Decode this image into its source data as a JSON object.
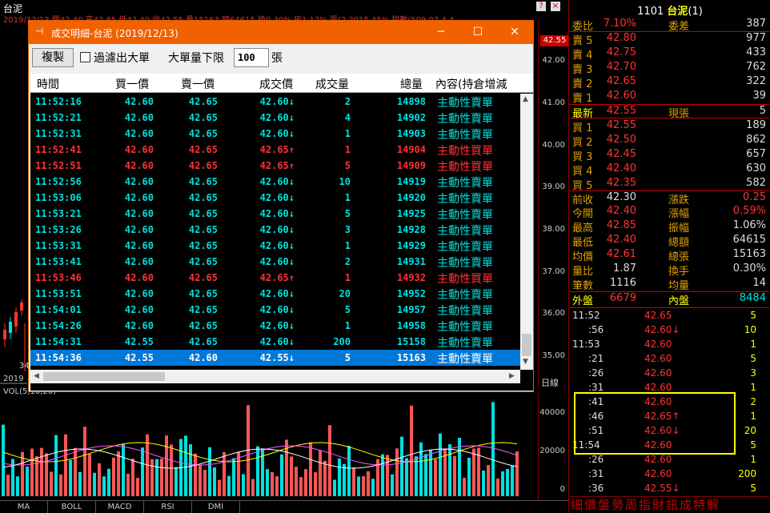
{
  "chart": {
    "title": "台泥",
    "infoline": "2019/12/13  開42.40 高42.85 低42.40 收42.55 量15163 額64615 換0.30% 振1.12% 張(2.2015.45% 指數(509.07 4.4",
    "price_ticks": [
      "42.00",
      "41.00",
      "40.00",
      "39.00",
      "38.00",
      "37.00",
      "36.00",
      "35.00"
    ],
    "current_price": "42.55",
    "rilou_label": "日線",
    "year_label": "2019",
    "small_label": "34",
    "vol_label": "VOL(5,10,20)",
    "vol_ticks": [
      "40000",
      "20000",
      "0"
    ],
    "tabs": [
      "MA",
      "BOLL",
      "MACD",
      "RSI",
      "DMI"
    ]
  },
  "dialog": {
    "title": "成交明細-台泥 (2019/12/13)",
    "copy_label": "複製",
    "filter_label": "過濾出大單",
    "min_label": "大單量下限",
    "min_value": "100",
    "min_unit": "張",
    "columns": [
      "時間",
      "買一價",
      "賣一價",
      "成交價",
      "成交量",
      "總量",
      "內容(持倉增減"
    ],
    "rows": [
      {
        "time": "11:52:16",
        "bid": "42.60",
        "ask": "42.65",
        "price": "42.60↓",
        "vol": "2",
        "total": "14898",
        "content": "主動性賣單",
        "side": "sell"
      },
      {
        "time": "11:52:21",
        "bid": "42.60",
        "ask": "42.65",
        "price": "42.60↓",
        "vol": "4",
        "total": "14902",
        "content": "主動性賣單",
        "side": "sell"
      },
      {
        "time": "11:52:31",
        "bid": "42.60",
        "ask": "42.65",
        "price": "42.60↓",
        "vol": "1",
        "total": "14903",
        "content": "主動性賣單",
        "side": "sell"
      },
      {
        "time": "11:52:41",
        "bid": "42.60",
        "ask": "42.65",
        "price": "42.65↑",
        "vol": "1",
        "total": "14904",
        "content": "主動性買單",
        "side": "buy"
      },
      {
        "time": "11:52:51",
        "bid": "42.60",
        "ask": "42.65",
        "price": "42.65↑",
        "vol": "5",
        "total": "14909",
        "content": "主動性買單",
        "side": "buy"
      },
      {
        "time": "11:52:56",
        "bid": "42.60",
        "ask": "42.65",
        "price": "42.60↓",
        "vol": "10",
        "total": "14919",
        "content": "主動性賣單",
        "side": "sell"
      },
      {
        "time": "11:53:06",
        "bid": "42.60",
        "ask": "42.65",
        "price": "42.60↓",
        "vol": "1",
        "total": "14920",
        "content": "主動性賣單",
        "side": "sell"
      },
      {
        "time": "11:53:21",
        "bid": "42.60",
        "ask": "42.65",
        "price": "42.60↓",
        "vol": "5",
        "total": "14925",
        "content": "主動性賣單",
        "side": "sell"
      },
      {
        "time": "11:53:26",
        "bid": "42.60",
        "ask": "42.65",
        "price": "42.60↓",
        "vol": "3",
        "total": "14928",
        "content": "主動性賣單",
        "side": "sell"
      },
      {
        "time": "11:53:31",
        "bid": "42.60",
        "ask": "42.65",
        "price": "42.60↓",
        "vol": "1",
        "total": "14929",
        "content": "主動性賣單",
        "side": "sell"
      },
      {
        "time": "11:53:41",
        "bid": "42.60",
        "ask": "42.65",
        "price": "42.60↓",
        "vol": "2",
        "total": "14931",
        "content": "主動性賣單",
        "side": "sell"
      },
      {
        "time": "11:53:46",
        "bid": "42.60",
        "ask": "42.65",
        "price": "42.65↑",
        "vol": "1",
        "total": "14932",
        "content": "主動性買單",
        "side": "buy"
      },
      {
        "time": "11:53:51",
        "bid": "42.60",
        "ask": "42.65",
        "price": "42.60↓",
        "vol": "20",
        "total": "14952",
        "content": "主動性賣單",
        "side": "sell"
      },
      {
        "time": "11:54:01",
        "bid": "42.60",
        "ask": "42.65",
        "price": "42.60↓",
        "vol": "5",
        "total": "14957",
        "content": "主動性賣單",
        "side": "sell"
      },
      {
        "time": "11:54:26",
        "bid": "42.60",
        "ask": "42.65",
        "price": "42.60↓",
        "vol": "1",
        "total": "14958",
        "content": "主動性賣單",
        "side": "sell"
      },
      {
        "time": "11:54:31",
        "bid": "42.55",
        "ask": "42.65",
        "price": "42.60↓",
        "vol": "200",
        "total": "15158",
        "content": "主動性賣單",
        "side": "sell"
      },
      {
        "time": "11:54:36",
        "bid": "42.55",
        "ask": "42.60",
        "price": "42.55↓",
        "vol": "5",
        "total": "15163",
        "content": "主動性賣單",
        "side": "sell",
        "selected": true
      }
    ]
  },
  "quote": {
    "code": "1101",
    "name": "台泥",
    "suffix": "(1)",
    "ratio_label": "委比",
    "ratio_value": "7.10%",
    "diff_label": "委差",
    "diff_value": "387",
    "asks": [
      {
        "label": "賣 5",
        "price": "42.80",
        "vol": "977"
      },
      {
        "label": "賣 4",
        "price": "42.75",
        "vol": "433"
      },
      {
        "label": "賣 3",
        "price": "42.70",
        "vol": "762"
      },
      {
        "label": "賣 2",
        "price": "42.65",
        "vol": "322"
      },
      {
        "label": "賣 1",
        "price": "42.60",
        "vol": "39"
      }
    ],
    "last_label": "最新",
    "last_price": "42.55",
    "cur_label": "現張",
    "cur_vol": "5",
    "bids": [
      {
        "label": "買 1",
        "price": "42.55",
        "vol": "189"
      },
      {
        "label": "買 2",
        "price": "42.50",
        "vol": "862"
      },
      {
        "label": "買 3",
        "price": "42.45",
        "vol": "657"
      },
      {
        "label": "買 4",
        "price": "42.40",
        "vol": "630"
      },
      {
        "label": "買 5",
        "price": "42.35",
        "vol": "582"
      }
    ],
    "stats": [
      {
        "l1": "前收",
        "v1": "42.30",
        "l2": "漲跌",
        "v2": "0.25"
      },
      {
        "l1": "今開",
        "v1": "42.40",
        "l2": "漲幅",
        "v2": "0.59%"
      },
      {
        "l1": "最高",
        "v1": "42.85",
        "l2": "振幅",
        "v2": "1.06%"
      },
      {
        "l1": "最低",
        "v1": "42.40",
        "l2": "總額",
        "v2": "64615"
      },
      {
        "l1": "均價",
        "v1": "42.61",
        "l2": "總張",
        "v2": "15163"
      },
      {
        "l1": "量比",
        "v1": "1.87",
        "l2": "換手",
        "v2": "0.30%"
      },
      {
        "l1": "筆數",
        "v1": "1116",
        "l2": "均量",
        "v2": "14"
      }
    ],
    "outer_label": "外盤",
    "outer_value": "6679",
    "inner_label": "內盤",
    "inner_value": "8484",
    "ticks": [
      {
        "time": "11:52",
        "price": "42.65",
        "vol": "5",
        "dir": "up"
      },
      {
        "time": ":56",
        "price": "42.60↓",
        "vol": "10",
        "dir": "down"
      },
      {
        "time": "11:53",
        "price": "42.60",
        "vol": "1",
        "dir": "down"
      },
      {
        "time": ":21",
        "price": "42.60",
        "vol": "5",
        "dir": "down"
      },
      {
        "time": ":26",
        "price": "42.60",
        "vol": "3",
        "dir": "down"
      },
      {
        "time": ":31",
        "price": "42.60",
        "vol": "1",
        "dir": "down"
      },
      {
        "time": ":41",
        "price": "42.60",
        "vol": "2",
        "dir": "down"
      },
      {
        "time": ":46",
        "price": "42.65↑",
        "vol": "1",
        "dir": "up"
      },
      {
        "time": ":51",
        "price": "42.60↓",
        "vol": "20",
        "dir": "down"
      },
      {
        "time": "11:54",
        "price": "42.60",
        "vol": "5",
        "dir": "down"
      },
      {
        "time": ":26",
        "price": "42.60",
        "vol": "1",
        "dir": "down"
      },
      {
        "time": ":31",
        "price": "42.60",
        "vol": "200",
        "dir": "down"
      },
      {
        "time": ":36",
        "price": "42.55↓",
        "vol": "5",
        "dir": "down"
      }
    ],
    "tabs": "細價盤勢周指財訊成特解"
  },
  "colors": {
    "up": "#ff3333",
    "down": "#00e0e0",
    "accent": "#f26100",
    "label": "#e0a000",
    "select": "#0078d7"
  }
}
